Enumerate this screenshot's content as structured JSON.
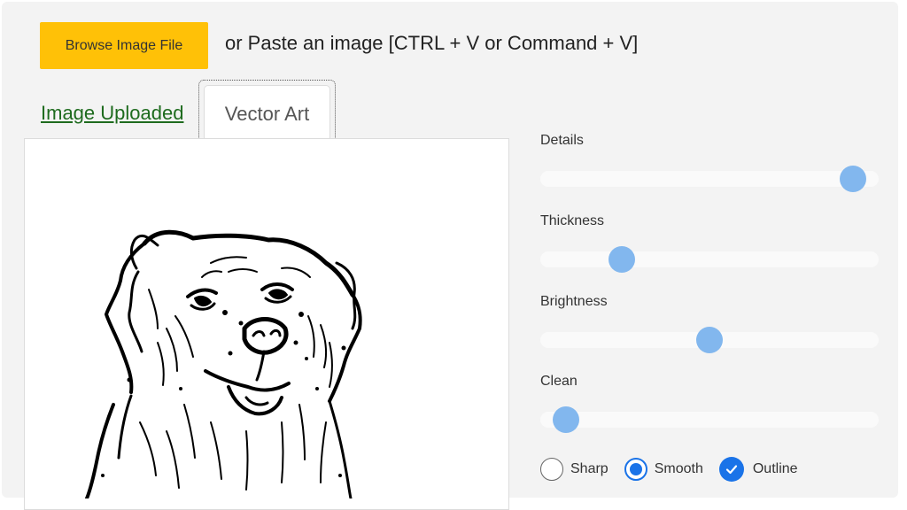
{
  "header": {
    "browse_label": "Browse Image File",
    "paste_hint": "or Paste an image [CTRL + V or Command + V]"
  },
  "tabs": {
    "image_uploaded": "Image Uploaded",
    "vector_art": "Vector Art"
  },
  "preview": {
    "alt": "vector art sketch of a dog"
  },
  "sliders": {
    "details": {
      "label": "Details",
      "value": 0.96
    },
    "thickness": {
      "label": "Thickness",
      "value": 0.22
    },
    "brightness": {
      "label": "Brightness",
      "value": 0.5
    },
    "clean": {
      "label": "Clean",
      "value": 0.04
    }
  },
  "options": {
    "sharp": {
      "label": "Sharp",
      "checked": false
    },
    "smooth": {
      "label": "Smooth",
      "checked": true
    },
    "outline": {
      "label": "Outline",
      "checked": true
    }
  },
  "colors": {
    "accent": "#1a73e8",
    "browse_button": "#ffc107",
    "slider_thumb": "#82b7ee",
    "tab_link": "#1e6b1e"
  }
}
